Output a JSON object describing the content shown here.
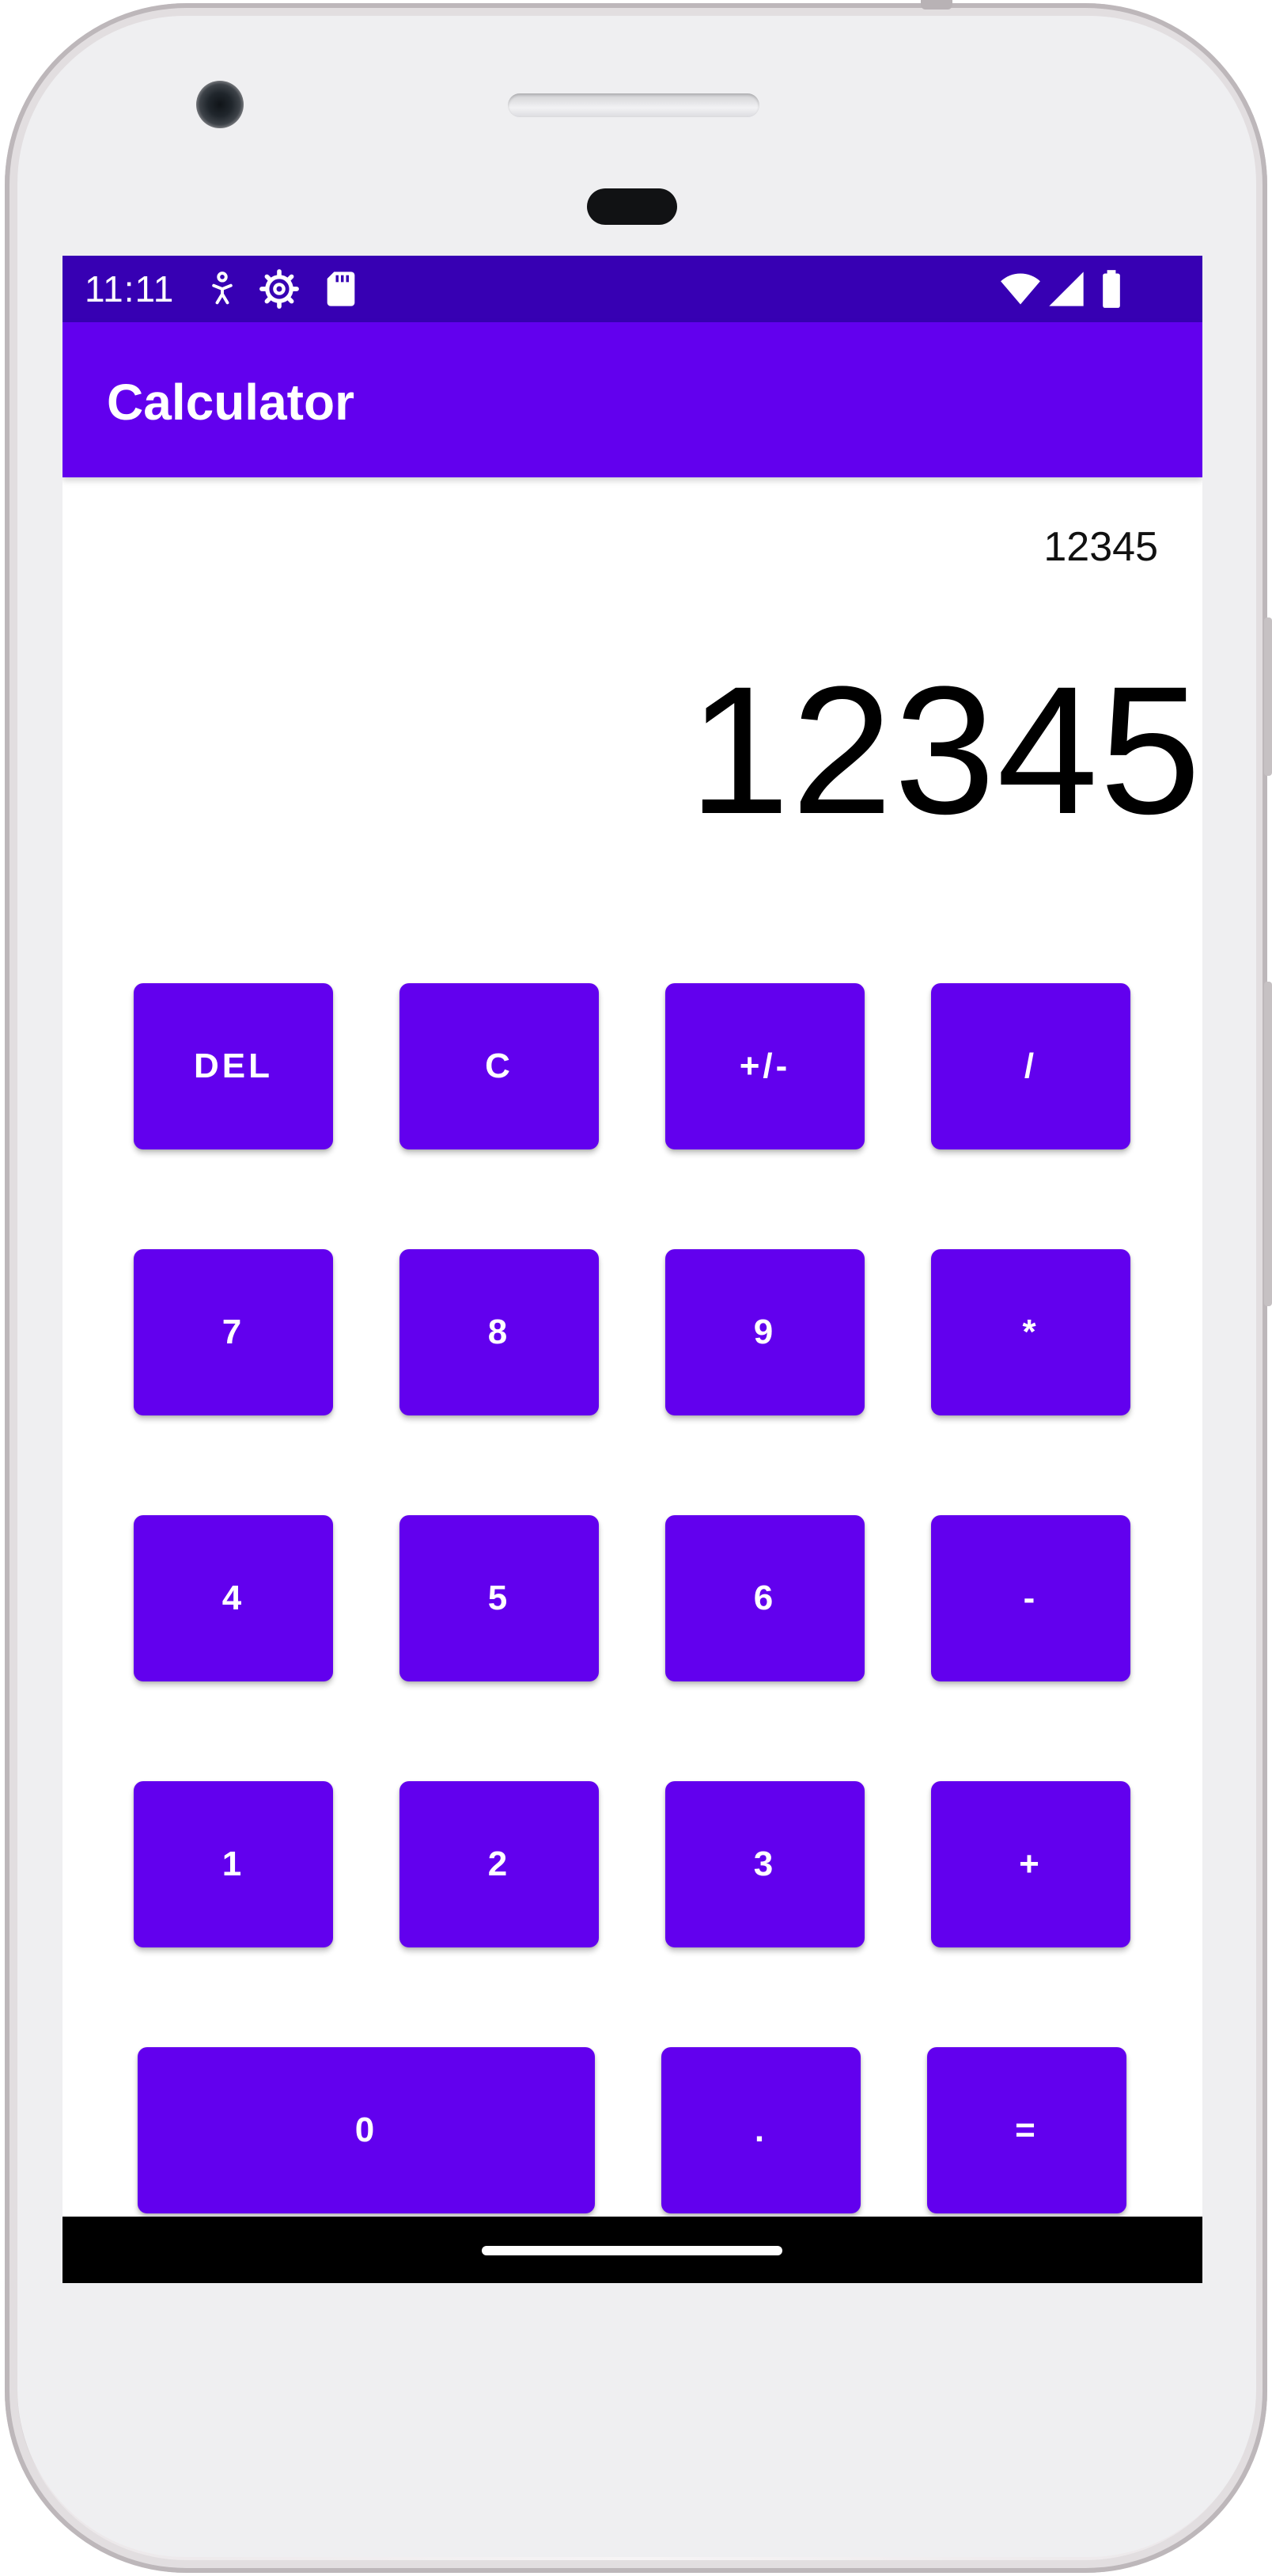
{
  "status_bar": {
    "time": "11:11",
    "left_icons": [
      "accessibility-icon",
      "settings-gear-icon",
      "sd-card-icon"
    ],
    "right_icons": [
      "wifi-icon",
      "cell-signal-icon",
      "battery-icon"
    ],
    "background_color": "#3700b3"
  },
  "app_bar": {
    "title": "Calculator",
    "background_color": "#6200ee"
  },
  "display": {
    "history": "12345",
    "result": "12345"
  },
  "keypad": {
    "button_color": "#6200ee",
    "keys": {
      "del": "DEL",
      "clear": "C",
      "negate": "+/-",
      "divide": "/",
      "seven": "7",
      "eight": "8",
      "nine": "9",
      "multiply": "*",
      "four": "4",
      "five": "5",
      "six": "6",
      "subtract": "-",
      "one": "1",
      "two": "2",
      "three": "3",
      "add": "+",
      "zero": "0",
      "decimal": ".",
      "equals": "="
    }
  },
  "nav_bar": {
    "home_indicator": "home-pill-icon"
  }
}
